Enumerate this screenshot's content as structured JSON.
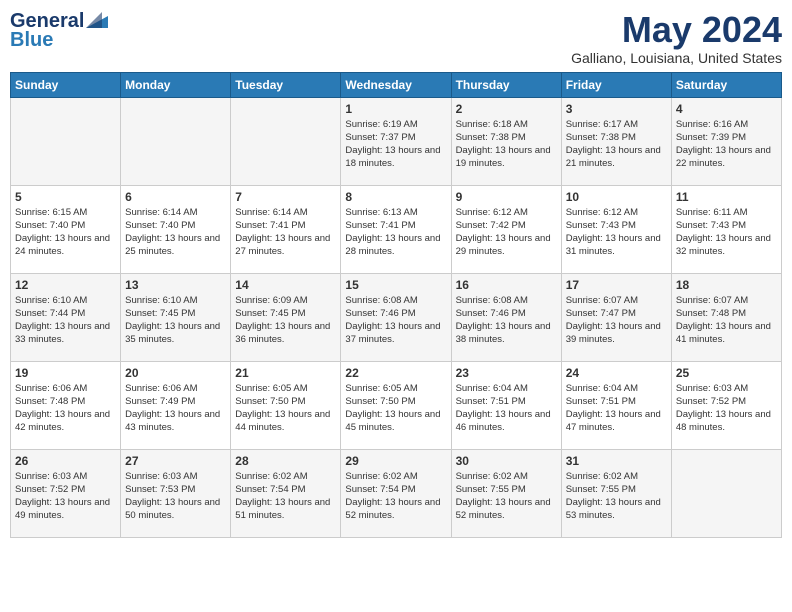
{
  "header": {
    "logo_line1": "General",
    "logo_line2": "Blue",
    "month_title": "May 2024",
    "location": "Galliano, Louisiana, United States"
  },
  "days_of_week": [
    "Sunday",
    "Monday",
    "Tuesday",
    "Wednesday",
    "Thursday",
    "Friday",
    "Saturday"
  ],
  "weeks": [
    [
      {
        "day": "",
        "info": ""
      },
      {
        "day": "",
        "info": ""
      },
      {
        "day": "",
        "info": ""
      },
      {
        "day": "1",
        "info": "Sunrise: 6:19 AM\nSunset: 7:37 PM\nDaylight: 13 hours\nand 18 minutes."
      },
      {
        "day": "2",
        "info": "Sunrise: 6:18 AM\nSunset: 7:38 PM\nDaylight: 13 hours\nand 19 minutes."
      },
      {
        "day": "3",
        "info": "Sunrise: 6:17 AM\nSunset: 7:38 PM\nDaylight: 13 hours\nand 21 minutes."
      },
      {
        "day": "4",
        "info": "Sunrise: 6:16 AM\nSunset: 7:39 PM\nDaylight: 13 hours\nand 22 minutes."
      }
    ],
    [
      {
        "day": "5",
        "info": "Sunrise: 6:15 AM\nSunset: 7:40 PM\nDaylight: 13 hours\nand 24 minutes."
      },
      {
        "day": "6",
        "info": "Sunrise: 6:14 AM\nSunset: 7:40 PM\nDaylight: 13 hours\nand 25 minutes."
      },
      {
        "day": "7",
        "info": "Sunrise: 6:14 AM\nSunset: 7:41 PM\nDaylight: 13 hours\nand 27 minutes."
      },
      {
        "day": "8",
        "info": "Sunrise: 6:13 AM\nSunset: 7:41 PM\nDaylight: 13 hours\nand 28 minutes."
      },
      {
        "day": "9",
        "info": "Sunrise: 6:12 AM\nSunset: 7:42 PM\nDaylight: 13 hours\nand 29 minutes."
      },
      {
        "day": "10",
        "info": "Sunrise: 6:12 AM\nSunset: 7:43 PM\nDaylight: 13 hours\nand 31 minutes."
      },
      {
        "day": "11",
        "info": "Sunrise: 6:11 AM\nSunset: 7:43 PM\nDaylight: 13 hours\nand 32 minutes."
      }
    ],
    [
      {
        "day": "12",
        "info": "Sunrise: 6:10 AM\nSunset: 7:44 PM\nDaylight: 13 hours\nand 33 minutes."
      },
      {
        "day": "13",
        "info": "Sunrise: 6:10 AM\nSunset: 7:45 PM\nDaylight: 13 hours\nand 35 minutes."
      },
      {
        "day": "14",
        "info": "Sunrise: 6:09 AM\nSunset: 7:45 PM\nDaylight: 13 hours\nand 36 minutes."
      },
      {
        "day": "15",
        "info": "Sunrise: 6:08 AM\nSunset: 7:46 PM\nDaylight: 13 hours\nand 37 minutes."
      },
      {
        "day": "16",
        "info": "Sunrise: 6:08 AM\nSunset: 7:46 PM\nDaylight: 13 hours\nand 38 minutes."
      },
      {
        "day": "17",
        "info": "Sunrise: 6:07 AM\nSunset: 7:47 PM\nDaylight: 13 hours\nand 39 minutes."
      },
      {
        "day": "18",
        "info": "Sunrise: 6:07 AM\nSunset: 7:48 PM\nDaylight: 13 hours\nand 41 minutes."
      }
    ],
    [
      {
        "day": "19",
        "info": "Sunrise: 6:06 AM\nSunset: 7:48 PM\nDaylight: 13 hours\nand 42 minutes."
      },
      {
        "day": "20",
        "info": "Sunrise: 6:06 AM\nSunset: 7:49 PM\nDaylight: 13 hours\nand 43 minutes."
      },
      {
        "day": "21",
        "info": "Sunrise: 6:05 AM\nSunset: 7:50 PM\nDaylight: 13 hours\nand 44 minutes."
      },
      {
        "day": "22",
        "info": "Sunrise: 6:05 AM\nSunset: 7:50 PM\nDaylight: 13 hours\nand 45 minutes."
      },
      {
        "day": "23",
        "info": "Sunrise: 6:04 AM\nSunset: 7:51 PM\nDaylight: 13 hours\nand 46 minutes."
      },
      {
        "day": "24",
        "info": "Sunrise: 6:04 AM\nSunset: 7:51 PM\nDaylight: 13 hours\nand 47 minutes."
      },
      {
        "day": "25",
        "info": "Sunrise: 6:03 AM\nSunset: 7:52 PM\nDaylight: 13 hours\nand 48 minutes."
      }
    ],
    [
      {
        "day": "26",
        "info": "Sunrise: 6:03 AM\nSunset: 7:52 PM\nDaylight: 13 hours\nand 49 minutes."
      },
      {
        "day": "27",
        "info": "Sunrise: 6:03 AM\nSunset: 7:53 PM\nDaylight: 13 hours\nand 50 minutes."
      },
      {
        "day": "28",
        "info": "Sunrise: 6:02 AM\nSunset: 7:54 PM\nDaylight: 13 hours\nand 51 minutes."
      },
      {
        "day": "29",
        "info": "Sunrise: 6:02 AM\nSunset: 7:54 PM\nDaylight: 13 hours\nand 52 minutes."
      },
      {
        "day": "30",
        "info": "Sunrise: 6:02 AM\nSunset: 7:55 PM\nDaylight: 13 hours\nand 52 minutes."
      },
      {
        "day": "31",
        "info": "Sunrise: 6:02 AM\nSunset: 7:55 PM\nDaylight: 13 hours\nand 53 minutes."
      },
      {
        "day": "",
        "info": ""
      }
    ]
  ]
}
